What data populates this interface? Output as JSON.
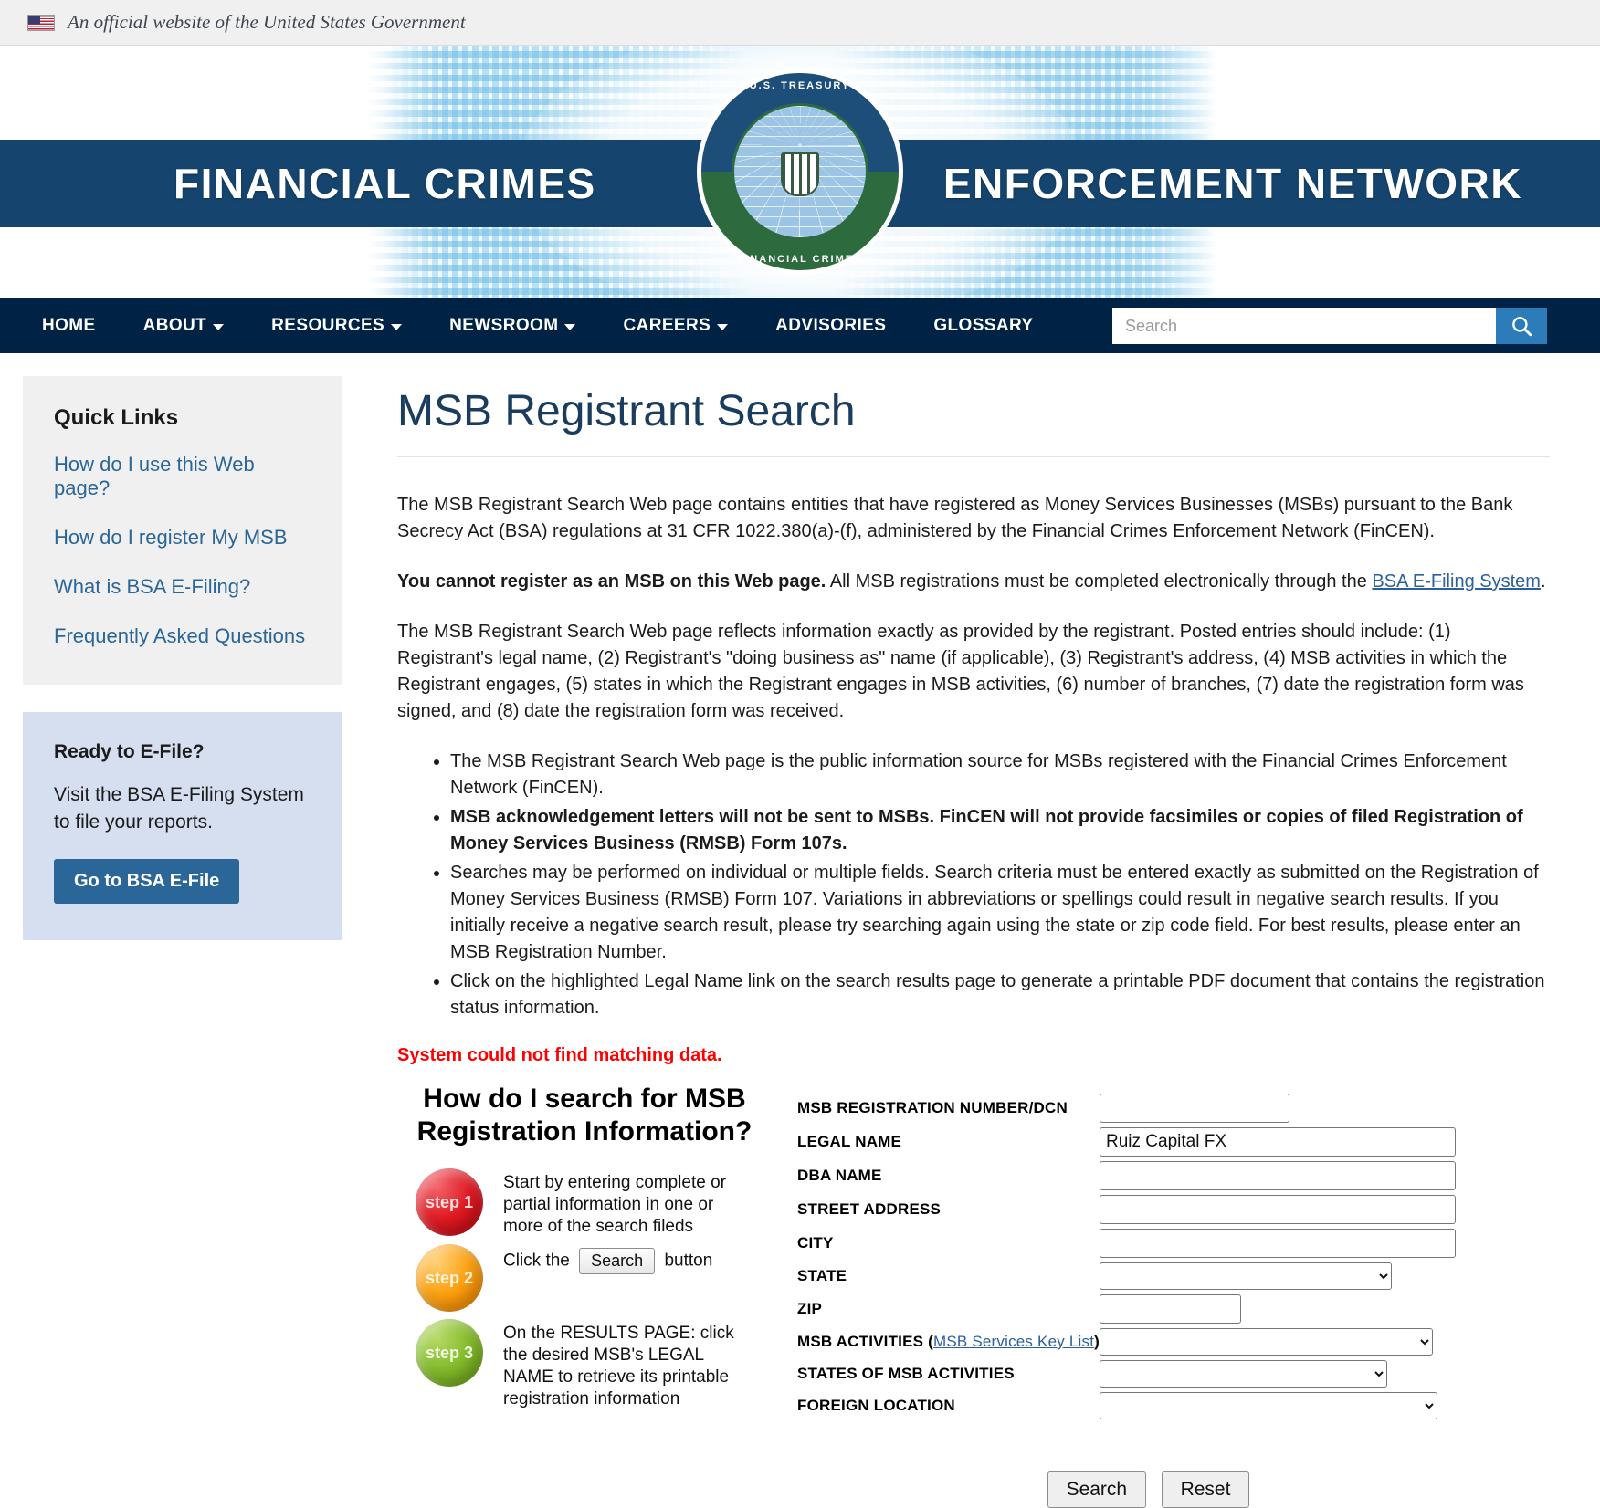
{
  "gov_banner": {
    "text": "An official website of the United States Government",
    "flag_icon": "us-flag-icon"
  },
  "masthead": {
    "left_text": "FINANCIAL CRIMES",
    "right_text": "ENFORCEMENT NETWORK",
    "seal_top": "U.S. TREASURY",
    "seal_bottom": "FINANCIAL CRIMES ENFORCEMENT NETWORK",
    "band_color": "#15456e"
  },
  "nav": {
    "items": [
      {
        "label": "HOME",
        "has_caret": false
      },
      {
        "label": "ABOUT",
        "has_caret": true
      },
      {
        "label": "RESOURCES",
        "has_caret": true
      },
      {
        "label": "NEWSROOM",
        "has_caret": true
      },
      {
        "label": "CAREERS",
        "has_caret": true
      },
      {
        "label": "ADVISORIES",
        "has_caret": false
      },
      {
        "label": "GLOSSARY",
        "has_caret": false
      }
    ],
    "search_placeholder": "Search",
    "search_value": "",
    "search_icon": "magnifier-icon",
    "bar_color": "#002244",
    "search_button_color": "#2b7cb8"
  },
  "sidebar": {
    "quick_links": {
      "title": "Quick Links",
      "links": [
        "How do I use this Web page?",
        "How do I register My MSB",
        "What is BSA E-Filing?",
        "Frequently Asked Questions"
      ]
    },
    "efile": {
      "title": "Ready to E-File?",
      "text": "Visit the BSA E-Filing System to file your reports.",
      "button": "Go to BSA E-File"
    }
  },
  "main": {
    "title": "MSB Registrant Search",
    "paragraph_1": "The MSB Registrant Search Web page contains entities that have registered as Money Services Businesses (MSBs) pursuant to the Bank Secrecy Act (BSA) regulations at 31 CFR 1022.380(a)-(f), administered by the Financial Crimes Enforcement Network (FinCEN).",
    "paragraph_2_bold": "You cannot register as an MSB on this Web page.",
    "paragraph_2_rest": " All MSB registrations must be completed electronically through the ",
    "paragraph_2_link": "BSA E-Filing System",
    "paragraph_2_end": ".",
    "paragraph_3": "The MSB Registrant Search Web page reflects information exactly as provided by the registrant. Posted entries should include: (1) Registrant's legal name, (2) Registrant's \"doing business as\" name (if applicable), (3) Registrant's address, (4) MSB activities in which the Registrant engages, (5) states in which the Registrant engages in MSB activities, (6) number of branches, (7) date the registration form was signed, and (8) date the registration form was received.",
    "bullets": [
      {
        "text": "The MSB Registrant Search Web page is the public information source for MSBs registered with the Financial Crimes Enforcement Network (FinCEN).",
        "bold": false
      },
      {
        "text": "MSB acknowledgement letters will not be sent to MSBs. FinCEN will not provide facsimiles or copies of filed Registration of Money Services Business (RMSB) Form 107s.",
        "bold": true
      },
      {
        "text": "Searches may be performed on individual or multiple fields. Search criteria must be entered exactly as submitted on the Registration of Money Services Business (RMSB) Form 107. Variations in abbreviations or spellings could result in negative search results. If you initially receive a negative search result, please try searching again using the state or zip code field. For best results, please enter an MSB Registration Number.",
        "bold": false
      },
      {
        "text": "Click on the highlighted Legal Name link on the search results page to generate a printable PDF document that contains the registration status information.",
        "bold": false
      }
    ],
    "error_message": "System could not find matching data.",
    "error_color": "#ff0000"
  },
  "steps_panel": {
    "heading": "How do I search for MSB Registration Information?",
    "steps": [
      {
        "badge": "step 1",
        "color": "#e01b24",
        "text_before": "Start by entering complete or partial information in one or more of the search fileds",
        "inline_button": "",
        "text_after": ""
      },
      {
        "badge": "step 2",
        "color": "#fca00f",
        "text_before": "Click the ",
        "inline_button": "Search",
        "text_after": " button"
      },
      {
        "badge": "step 3",
        "color": "#84bb2c",
        "text_before": "On the RESULTS PAGE: click the desired MSB's LEGAL NAME to retrieve its printable registration information",
        "inline_button": "",
        "text_after": ""
      }
    ]
  },
  "search_form": {
    "fields": [
      {
        "label": "MSB REGISTRATION NUMBER/DCN",
        "type": "text",
        "value": "",
        "width": "short"
      },
      {
        "label": "LEGAL NAME",
        "type": "text",
        "value": "Ruiz Capital FX",
        "width": "long"
      },
      {
        "label": "DBA NAME",
        "type": "text",
        "value": "",
        "width": "long"
      },
      {
        "label": "STREET ADDRESS",
        "type": "text",
        "value": "",
        "width": "long"
      },
      {
        "label": "CITY",
        "type": "text",
        "value": "",
        "width": "long"
      },
      {
        "label": "STATE",
        "type": "select",
        "value": "",
        "width": "sel-state"
      },
      {
        "label": "ZIP",
        "type": "text",
        "value": "",
        "width": "zip"
      },
      {
        "label": "MSB ACTIVITIES",
        "label_link": "MSB Services Key List",
        "type": "select",
        "value": "",
        "width": "sel-act"
      },
      {
        "label": "STATES OF MSB ACTIVITIES",
        "type": "select",
        "value": "",
        "width": "sel-states"
      },
      {
        "label": "FOREIGN LOCATION",
        "type": "select",
        "value": "",
        "width": "sel-foreign"
      }
    ],
    "search_button": "Search",
    "reset_button": "Reset"
  }
}
